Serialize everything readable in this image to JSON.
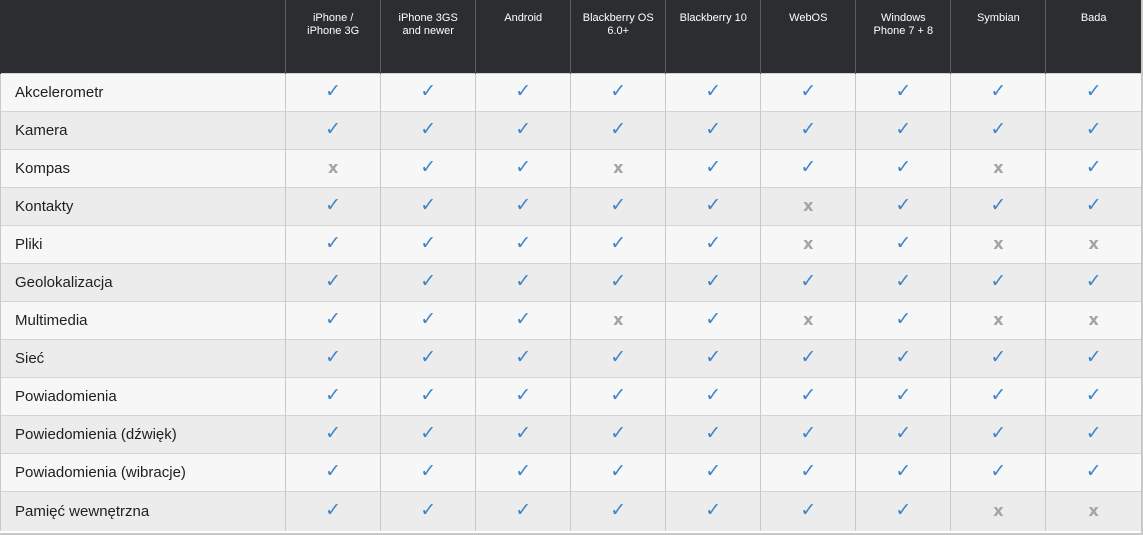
{
  "table": {
    "columns": [
      "iPhone /\niPhone 3G",
      "iPhone 3GS\nand newer",
      "Android",
      "Blackberry OS\n6.0+",
      "Blackberry 10",
      "WebOS",
      "Windows\nPhone 7 + 8",
      "Symbian",
      "Bada"
    ],
    "symbols": {
      "yes": "✓",
      "no": "x"
    },
    "colors": {
      "yes": "#3f84c6",
      "no": "#a4a4a4",
      "header_bg": "#2b2d31"
    },
    "rows": [
      {
        "label": "Akcelerometr",
        "values": [
          true,
          true,
          true,
          true,
          true,
          true,
          true,
          true,
          true
        ]
      },
      {
        "label": "Kamera",
        "values": [
          true,
          true,
          true,
          true,
          true,
          true,
          true,
          true,
          true
        ]
      },
      {
        "label": "Kompas",
        "values": [
          false,
          true,
          true,
          false,
          true,
          true,
          true,
          false,
          true
        ]
      },
      {
        "label": "Kontakty",
        "values": [
          true,
          true,
          true,
          true,
          true,
          false,
          true,
          true,
          true
        ]
      },
      {
        "label": "Pliki",
        "values": [
          true,
          true,
          true,
          true,
          true,
          false,
          true,
          false,
          false
        ]
      },
      {
        "label": "Geolokalizacja",
        "values": [
          true,
          true,
          true,
          true,
          true,
          true,
          true,
          true,
          true
        ]
      },
      {
        "label": "Multimedia",
        "values": [
          true,
          true,
          true,
          false,
          true,
          false,
          true,
          false,
          false
        ]
      },
      {
        "label": "Sieć",
        "values": [
          true,
          true,
          true,
          true,
          true,
          true,
          true,
          true,
          true
        ]
      },
      {
        "label": "Powiadomienia",
        "values": [
          true,
          true,
          true,
          true,
          true,
          true,
          true,
          true,
          true
        ]
      },
      {
        "label": "Powiedomienia (dźwięk)",
        "values": [
          true,
          true,
          true,
          true,
          true,
          true,
          true,
          true,
          true
        ]
      },
      {
        "label": "Powiadomienia (wibracje)",
        "values": [
          true,
          true,
          true,
          true,
          true,
          true,
          true,
          true,
          true
        ]
      },
      {
        "label": "Pamięć wewnętrzna",
        "values": [
          true,
          true,
          true,
          true,
          true,
          true,
          true,
          false,
          false
        ]
      }
    ]
  }
}
